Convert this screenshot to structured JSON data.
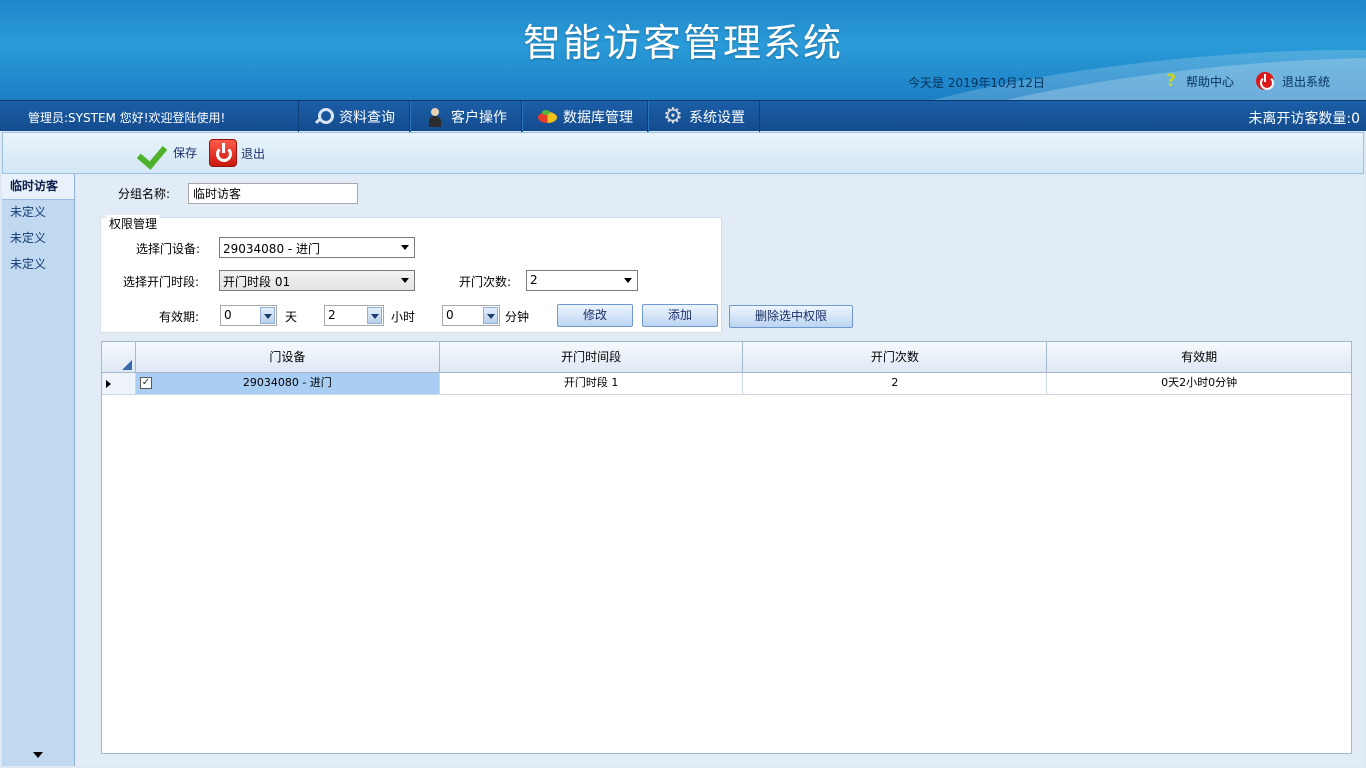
{
  "header": {
    "title": "智能访客管理系统",
    "date": "今天是 2019年10月12日",
    "help_label": "帮助中心",
    "logout_label": "退出系统"
  },
  "nav": {
    "admin": "管理员:SYSTEM 您好!欢迎登陆使用!",
    "menu": [
      {
        "label": "资料查询",
        "icon": "magnifier-icon"
      },
      {
        "label": "客户操作",
        "icon": "person-icon"
      },
      {
        "label": "数据库管理",
        "icon": "database-icon"
      },
      {
        "label": "系统设置",
        "icon": "gear-icon"
      }
    ],
    "visitor_count": "未离开访客数量:0"
  },
  "toolbar": {
    "save_label": "保存",
    "exit_label": "退出"
  },
  "sidebar": {
    "items": [
      {
        "label": "临时访客",
        "active": true
      },
      {
        "label": "未定义"
      },
      {
        "label": "未定义"
      },
      {
        "label": "未定义"
      }
    ]
  },
  "form": {
    "group_name_label": "分组名称:",
    "group_name_value": "临时访客",
    "perm_legend": "权限管理",
    "door_label": "选择门设备:",
    "door_value": "29034080 - 进门",
    "period_label": "选择开门时段:",
    "period_value": "开门时段 01",
    "times_label": "开门次数:",
    "times_value": "2",
    "valid_label": "有效期:",
    "days_value": "0",
    "days_unit": "天",
    "hours_value": "2",
    "hours_unit": "小时",
    "minutes_value": "0",
    "minutes_unit": "分钟",
    "modify_label": "修改",
    "add_label": "添加",
    "delete_label": "删除选中权限"
  },
  "grid": {
    "columns": [
      "门设备",
      "开门时间段",
      "开门次数",
      "有效期"
    ],
    "rows": [
      {
        "checked": true,
        "door": "29034080 - 进门",
        "period": "开门时段 1",
        "times": "2",
        "valid": "0天2小时0分钟"
      }
    ]
  }
}
